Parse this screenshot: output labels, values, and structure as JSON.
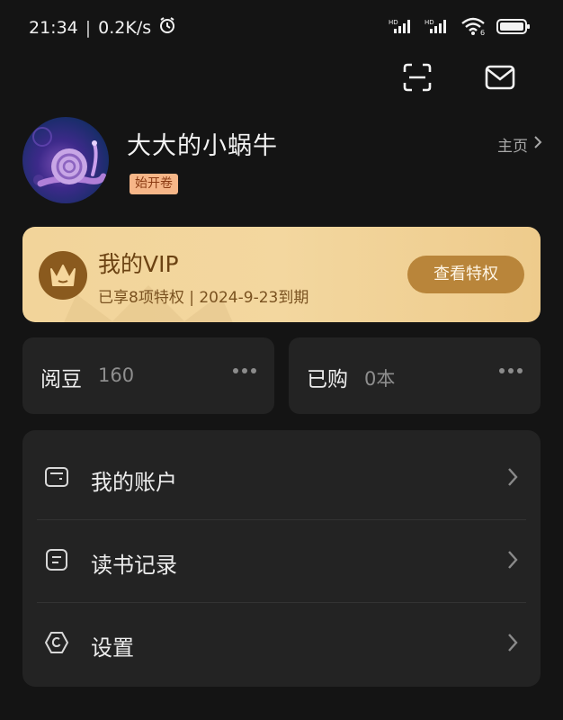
{
  "status_bar": {
    "time": "21:34",
    "network_speed": "0.2K/s",
    "icons": [
      "alarm-icon",
      "hd-signal-icon",
      "hd-signal-icon",
      "wifi-icon",
      "battery-icon"
    ],
    "wifi_badge": "6",
    "hd_label": "HD"
  },
  "top_actions": {
    "icons": [
      "scan-icon",
      "mail-icon"
    ]
  },
  "profile": {
    "username": "大大的小蜗牛",
    "badge": "始开卷",
    "homepage_label": "主页"
  },
  "vip": {
    "title": "我的VIP",
    "subtitle": "已享8项特权 | 2024-9-23到期",
    "button_label": "查看特权",
    "colors": {
      "card": "#f2d49a",
      "button": "#b9853a",
      "emblem": "#8a5a1e"
    }
  },
  "stats": [
    {
      "label": "阅豆",
      "value": "160"
    },
    {
      "label": "已购",
      "value": "0本"
    }
  ],
  "menu": [
    {
      "label": "我的账户",
      "icon": "wallet-icon"
    },
    {
      "label": "读书记录",
      "icon": "record-icon"
    },
    {
      "label": "设置",
      "icon": "settings-icon"
    }
  ]
}
